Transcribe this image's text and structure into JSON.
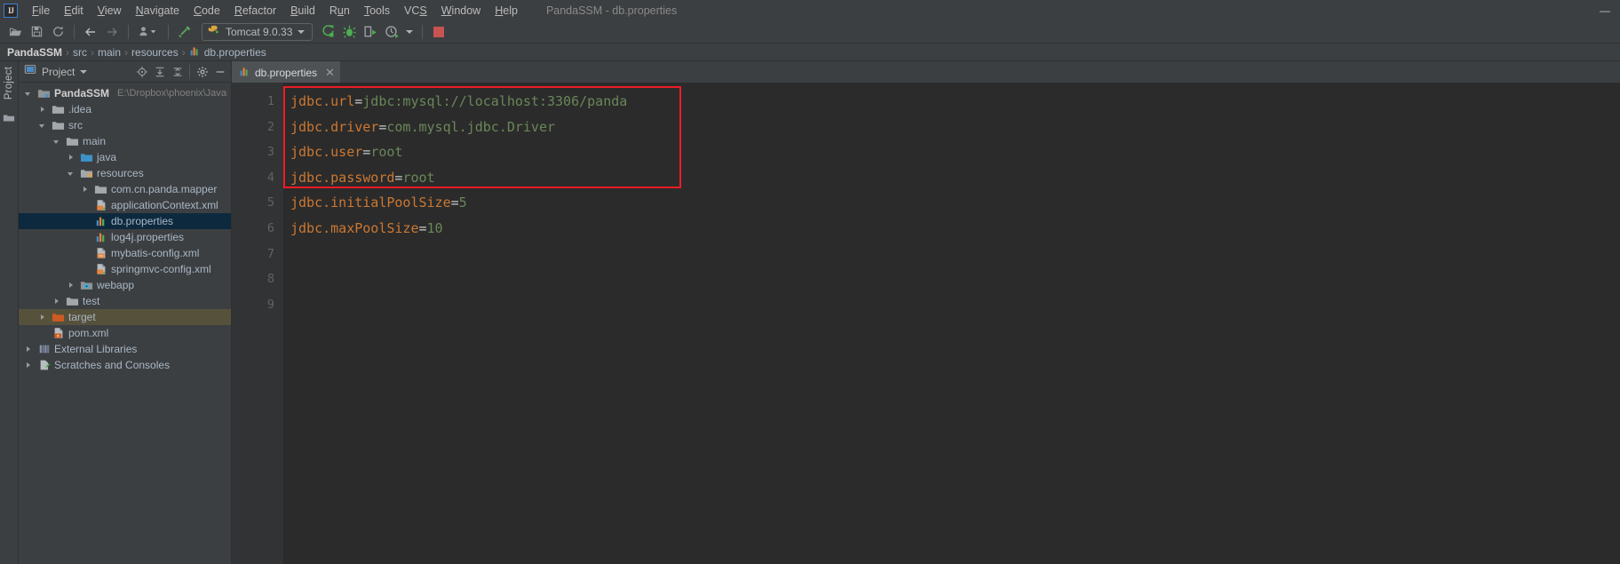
{
  "window": {
    "title": "PandaSSM - db.properties",
    "logo_text": "IJ",
    "controls": [
      {
        "name": "minimize",
        "glyph": "—"
      }
    ]
  },
  "menubar": {
    "items": [
      {
        "label": "File",
        "mnemonic": "F"
      },
      {
        "label": "Edit",
        "mnemonic": "E"
      },
      {
        "label": "View",
        "mnemonic": "V"
      },
      {
        "label": "Navigate",
        "mnemonic": "N"
      },
      {
        "label": "Code",
        "mnemonic": "C"
      },
      {
        "label": "Refactor",
        "mnemonic": "R"
      },
      {
        "label": "Build",
        "mnemonic": "B"
      },
      {
        "label": "Run",
        "mnemonic": "u"
      },
      {
        "label": "Tools",
        "mnemonic": "T"
      },
      {
        "label": "VCS",
        "mnemonic": "S"
      },
      {
        "label": "Window",
        "mnemonic": "W"
      },
      {
        "label": "Help",
        "mnemonic": "H"
      }
    ]
  },
  "toolbar": {
    "icons": [
      "open-folder-icon",
      "save-all-icon",
      "sync-refresh-icon",
      "back-arrow-icon",
      "forward-arrow-icon",
      "profile-dropdown-icon",
      "build-hammer-icon"
    ],
    "run_config": {
      "label": "Tomcat 9.0.33",
      "icon": "tomcat-icon"
    },
    "run_icons": [
      "run-icon",
      "debug-icon",
      "run-with-coverage-icon",
      "profiler-icon"
    ],
    "stop_icon": "stop-icon",
    "stop_color": "#c75450"
  },
  "breadcrumb": {
    "items": [
      {
        "label": "PandaSSM",
        "icon": null
      },
      {
        "label": "src",
        "icon": null
      },
      {
        "label": "main",
        "icon": null
      },
      {
        "label": "resources",
        "icon": null
      },
      {
        "label": "db.properties",
        "icon": "properties-file-icon"
      }
    ],
    "separator": "›"
  },
  "toolstrip": {
    "label": "Project",
    "icons": [
      "project-panel-icon",
      "structure-folder-icon"
    ]
  },
  "project_panel": {
    "title": "Project",
    "header_icons": [
      "locate-target-icon",
      "expand-all-icon",
      "collapse-all-icon",
      "settings-gear-icon",
      "hide-panel-icon"
    ],
    "tree": [
      {
        "label": "PandaSSM",
        "path": "E:\\Dropbox\\phoenix\\JavaPro",
        "depth": 0,
        "arrow": "down",
        "icon": "project-module-icon",
        "bold": true,
        "state": "normal"
      },
      {
        "label": ".idea",
        "depth": 1,
        "arrow": "right",
        "icon": "folder-icon",
        "state": "normal"
      },
      {
        "label": "src",
        "depth": 1,
        "arrow": "down",
        "icon": "folder-icon",
        "state": "normal"
      },
      {
        "label": "main",
        "depth": 2,
        "arrow": "down",
        "icon": "folder-icon",
        "state": "normal"
      },
      {
        "label": "java",
        "depth": 3,
        "arrow": "right",
        "icon": "source-folder-icon",
        "state": "normal"
      },
      {
        "label": "resources",
        "depth": 3,
        "arrow": "down",
        "icon": "resources-folder-icon",
        "state": "normal"
      },
      {
        "label": "com.cn.panda.mapper",
        "depth": 4,
        "arrow": "right",
        "icon": "folder-icon",
        "state": "normal"
      },
      {
        "label": "applicationContext.xml",
        "depth": 4,
        "arrow": "none",
        "icon": "spring-xml-icon",
        "state": "normal"
      },
      {
        "label": "db.properties",
        "depth": 4,
        "arrow": "none",
        "icon": "properties-file-icon",
        "state": "selected"
      },
      {
        "label": "log4j.properties",
        "depth": 4,
        "arrow": "none",
        "icon": "properties-file-icon",
        "state": "normal"
      },
      {
        "label": "mybatis-config.xml",
        "depth": 4,
        "arrow": "none",
        "icon": "xml-file-icon",
        "state": "normal"
      },
      {
        "label": "springmvc-config.xml",
        "depth": 4,
        "arrow": "none",
        "icon": "spring-xml-icon",
        "state": "normal"
      },
      {
        "label": "webapp",
        "depth": 3,
        "arrow": "right",
        "icon": "web-folder-icon",
        "state": "normal"
      },
      {
        "label": "test",
        "depth": 2,
        "arrow": "right",
        "icon": "folder-icon",
        "state": "normal"
      },
      {
        "label": "target",
        "depth": 1,
        "arrow": "right",
        "icon": "excluded-folder-icon",
        "state": "highlighted"
      },
      {
        "label": "pom.xml",
        "depth": 1,
        "arrow": "none",
        "icon": "maven-xml-icon",
        "state": "normal"
      },
      {
        "label": "External Libraries",
        "depth": 0,
        "arrow": "right",
        "icon": "libraries-icon",
        "state": "normal"
      },
      {
        "label": "Scratches and Consoles",
        "depth": 0,
        "arrow": "right",
        "icon": "scratches-icon",
        "state": "normal"
      }
    ]
  },
  "editor": {
    "tabs": [
      {
        "label": "db.properties",
        "icon": "properties-file-icon",
        "close_glyph": "✕",
        "active": true
      }
    ],
    "line_numbers": [
      "1",
      "2",
      "3",
      "4",
      "5",
      "6",
      "7",
      "8",
      "9"
    ],
    "lines": [
      {
        "key": "jdbc.url",
        "eq": "=",
        "value": "jdbc:mysql://localhost:3306/panda",
        "value_kind": "text"
      },
      {
        "key": "jdbc.driver",
        "eq": "=",
        "value": "com.mysql.jdbc.Driver",
        "value_kind": "text"
      },
      {
        "key": "jdbc.user",
        "eq": "=",
        "value": "root",
        "value_kind": "text"
      },
      {
        "key": "jdbc.password",
        "eq": "=",
        "value": "root",
        "value_kind": "text"
      },
      {
        "key": "jdbc.initialPoolSize",
        "eq": "=",
        "value": "5",
        "value_kind": "number"
      },
      {
        "key": "jdbc.maxPoolSize",
        "eq": "=",
        "value": "10",
        "value_kind": "number"
      }
    ],
    "annotation": {
      "name": "red-highlight-rectangle",
      "color": "#ee1c25",
      "covers_lines": [
        1,
        2,
        3,
        4
      ]
    },
    "colors": {
      "key": "#cc7832",
      "equals": "#c8c8c8",
      "value": "#6a8759",
      "background": "#2b2b2b",
      "gutter_background": "#313335",
      "line_number": "#606366"
    }
  }
}
